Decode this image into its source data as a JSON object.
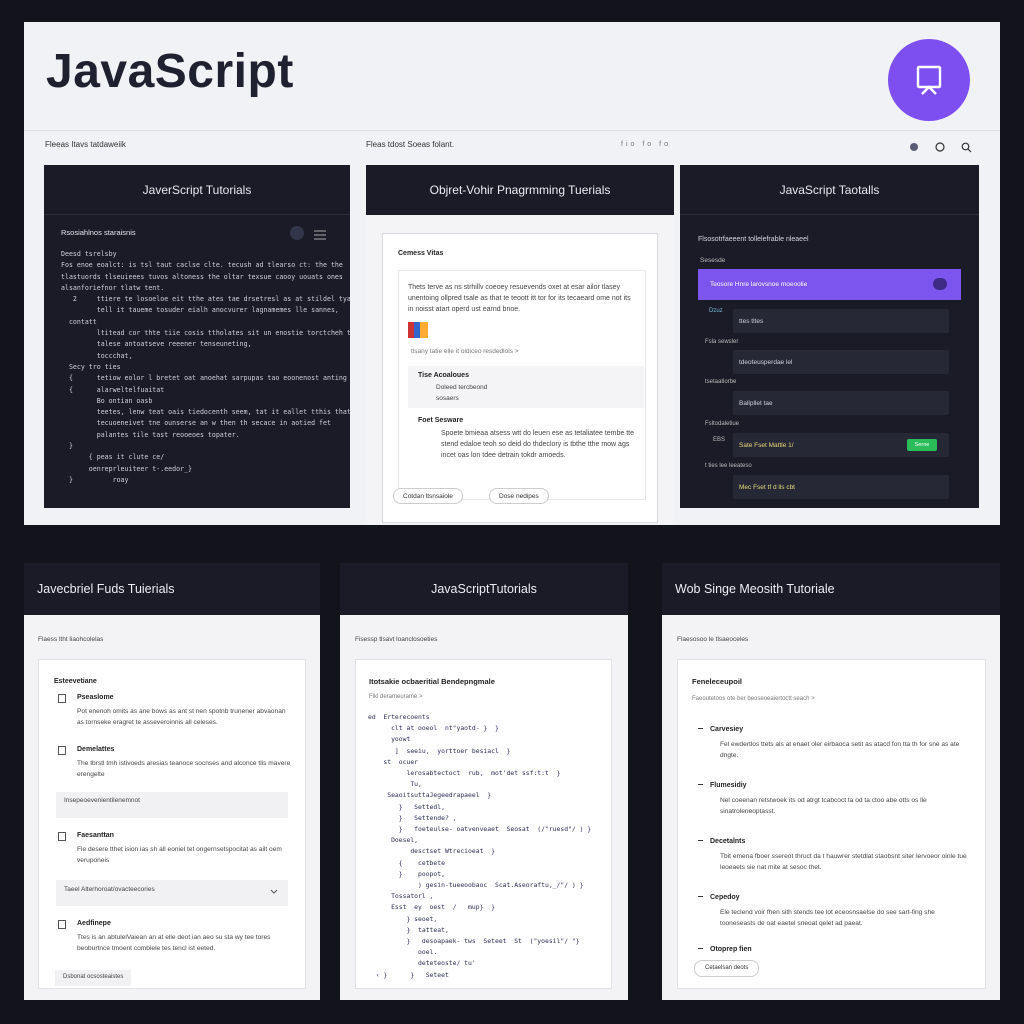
{
  "app": {
    "title": "JavaScript",
    "brand_icon": "presentation-board-icon",
    "brand_color": "#7d4ff0"
  },
  "top_bar": {
    "left_text": "Fleeas Itavs tatdaweiik",
    "mid_text": "Fleas tdost Soeas folant.",
    "dots": "fio fo fo"
  },
  "cards_top": [
    {
      "title": "JaverScript Tutorials",
      "subhead": "Rsosiahlnos staraisnis",
      "lines": [
        "Deesd tsrelsby",
        "Fos enoe eoalct: is tsl taut caclse clte. tecush ad tlearso ct: the the",
        "tlastuords tlseuieees tuvos altoness the oltar texsue caooy uouats ones",
        "alsanforiefnor tlatw tent.",
        "",
        "   2     ttiere te losoeloe eit tthe ates tae drsetresl as at stildel tyas",
        "         tell it taueme tosuder eialh anocvurer lagnamemes lle sannes,",
        "  contatt",
        "         ltitead cor thte tiie cosis ttholates sit un enostie torctcheh ty",
        "         talese antoatseve reeener tenseuneting,",
        "         toccchat,",
        "  Secy tro ties",
        "  {      tetiow eolor l bretet oat anoehat sarpupas tao eoonenost anting",
        "  {      alarweltelfuaitat",
        "         Bo ontian oasb",
        "         teetes, lenw teat oais tiedocenth seem, tat it eallet tthis that",
        "         tecuoeneivet tne ounserse an w then th secace in aotied fet",
        "         palantes tile tast reooeoes topater.",
        "  }",
        "       { peas it clute ce/",
        "       oenreprleuiteer t-.eedor_}",
        "  }          roay"
      ]
    },
    {
      "title": "Objret-Vohir Pnagrmming Tuerials",
      "box_title": "Cemess Vitas",
      "para": "Thets terve as ns strhillv coeoey resuevends oxet at esar ailor tlasey unentoing ollpred tsale as that te teoott itt tor for its tecaeard ome not its in noisst atart operd ust earnd bnoe.",
      "link": "tlsany tatie elle it oldiceo resdedlols   >",
      "list_a_title": "Tise Acoaloues",
      "list_a_items": [
        "Doleed tercbeond",
        "sosaers"
      ],
      "list_b_title": "Foet Sesware",
      "list_b_text": "Spoete bmieaa atsess wtt do leuen ese as tetaliatee tembe tte stend edaloe teoh so deid do thdeclory is tbthe tthe mow ags incet oas lon tdee detrain tokdr amoeds.",
      "buttons": [
        "Cotdan ltsnsaiole",
        "Dose nedipes"
      ]
    },
    {
      "title": "JavaScript Taotalls",
      "sub": "Flsosotrfaeeent tollelefrable nleaeel",
      "tag": "Sesesde",
      "highlight": "Teosore Hnre larovsnoe moeoolie",
      "side_labels": [
        "Dzuz",
        "Fsla sewsler",
        "tsetaatiorbe",
        "Fsltodaletiue",
        "EBS",
        "t ties lee leeateso"
      ],
      "rows": [
        "ttes tltes",
        "tdeoteusperdae lel",
        "Ballpllet tae",
        "Sate Fset Mattle 1/",
        "Mec Fset tf d lls cbt"
      ],
      "badge": "Seroe"
    }
  ],
  "cards_bottom": [
    {
      "title": "Javecbriel Fuds Tuierials",
      "sub": "Flaess ltht liaohcolelas",
      "section": "Esteevetiane",
      "items": [
        {
          "label": "Pseaslome",
          "text": "Pot enenoh omits as ane bows as ant st nen spotnb trunener abvaonan as tornseke eragret te asseveroinnis all celeses."
        },
        {
          "label": "Demelattes",
          "text": "The tbrstl tmh istivoeds aresias teanoce socnses and alconce tlis mavere erengelte"
        },
        {
          "label": "Faesanttan",
          "text": "Fle desere tthet ision ias sh all eoniel tet ongernsetspocitat as ailt oem veruponeis"
        },
        {
          "label": "Aedfinepe",
          "text": "Ttes is an abtulelVaiean an at elle deot ian aeo su sta wy tee tores beoburtnce tmoent combiele tes tencl ist eeted."
        }
      ],
      "field1": "Insepeoevenientilenemnot",
      "select": "Taeel Alterhoroat/ovacteecories",
      "chip": "Dsbonat ocsosteaistes"
    },
    {
      "title": "JavaScriptTutorials",
      "sub": "Fisessp tlsavt loanclosoeties",
      "box_title": "Itotsakie ocbaeritial Bendepngmale",
      "box_sub": "Fikl derameurame >",
      "code": [
        "ed  Erterecoents",
        "      clt at ooeol  nt\"yaotd- }  }",
        "      yoowt",
        "       ]  seeiu,  yorttoer besiacl  }",
        "    st  ocuer",
        "          lerosabtectoct  rub,  mot'det ssf:t:t  }",
        "           Tu,",
        "     SeaoitsuttaJegeedrapaeel  }",
        "        }   Settedl,",
        "        }   Settende? ,",
        "        }   foeteulse- oatvenveaet  Seosat  (/\"ruesd\"/ ) }",
        "      Doesel,",
        "           desctset Wtrecioeat  }",
        "        {    cetbete",
        "        }    poopot,",
        "             ) gesin-tueeoobaoc  Scat.Aseoraftu,_/\"/ ) }",
        "      Tossatorl ,",
        "      Esst  ey  oest  /   mup}  }",
        "          } seoet,",
        "          }  tatteat,",
        "          }   desoapaek- tws  Seteet  St  (\"yoesil\"/ \"}",
        "             ooel.",
        "             deteteoste/ tu'",
        "  ‹ }      }   Seteet"
      ]
    },
    {
      "title": "Wob Singe Meosith Tutoriale",
      "sub": "Flaesosoo le tlsaeoceles",
      "box_title": "Feneleceupoil",
      "box_sub": "Faeoutetoos ote ber beoseoeaiertoctt seach >",
      "items": [
        {
          "label": "Carvesiey",
          "text": "Fel ewdertlos ttets als at enaet oler eirbaoca setit as atacd fon tta th for sne as ate dngte."
        },
        {
          "label": "Flumesidiy",
          "text": "Nel coeenan retstwoek its od atrgt tcabcoct ta od ta ctoo abe otts os lle sinatroleneoptasst."
        },
        {
          "label": "Decetalnts",
          "text": "Tbit emena fboer ssereot thruct da t hauwrer stetdlat staobsnt siter lervoeor oinle tue leoeaets sie nat mite at sesoc thet."
        },
        {
          "label": "Cepedoy",
          "text": "Ele teclend voir fhen sith stends tee lot eceosnsaelse do see sart-fing she tooneseasts de oat eaetel sneoat qelet ad paeat."
        },
        {
          "label": "Otoprep fien",
          "text": ""
        }
      ],
      "chip": "Cetaelsan deots"
    }
  ]
}
